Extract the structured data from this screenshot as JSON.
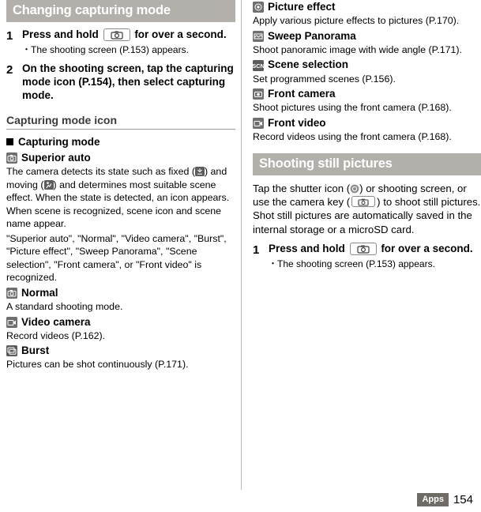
{
  "left": {
    "section_title": "Changing capturing mode",
    "steps": [
      {
        "num": "1",
        "title_pre": "Press and hold",
        "title_post": "for over a second.",
        "bullets": [
          "The shooting screen (P.153) appears."
        ]
      },
      {
        "num": "2",
        "title": "On the shooting screen, tap the capturing mode icon (P.154), then select capturing mode.",
        "bullets": []
      }
    ],
    "sub_head": "Capturing mode icon",
    "block_head": "Capturing mode",
    "modes": [
      {
        "icon": "superior-auto-icon",
        "label": "Superior auto",
        "body": "The camera detects its state such as fixed ( ) and moving ( ) and determines most suitable scene effect. When the state is detected, an icon appears. When scene is recognized, scene icon and scene name appear."
      }
    ],
    "quote_paragraph": "\"Superior auto\", \"Normal\", \"Video camera\", \"Burst\", \"Picture effect\", \"Sweep Panorama\", \"Scene selection\", \"Front camera\", or \"Front video\" is recognized.",
    "modes2": [
      {
        "icon": "normal-icon",
        "label": "Normal",
        "body": "A standard shooting mode."
      },
      {
        "icon": "video-camera-icon",
        "label": "Video camera",
        "body": "Record videos (P.162)."
      },
      {
        "icon": "burst-icon",
        "label": "Burst",
        "body": "Pictures can be shot continuously (P.171)."
      }
    ]
  },
  "right": {
    "modes": [
      {
        "icon": "picture-effect-icon",
        "label": "Picture effect",
        "body": "Apply various picture effects to pictures (P.170)."
      },
      {
        "icon": "sweep-panorama-icon",
        "label": "Sweep Panorama",
        "body": "Shoot panoramic image with wide angle (P.171)."
      },
      {
        "icon": "scene-selection-icon",
        "label": "Scene selection",
        "body": "Set programmed scenes (P.156)."
      },
      {
        "icon": "front-camera-icon",
        "label": "Front camera",
        "body": "Shoot pictures using the front camera (P.168)."
      },
      {
        "icon": "front-video-icon",
        "label": "Front video",
        "body": "Record videos using the front camera (P.168)."
      }
    ],
    "section_title": "Shooting still pictures",
    "intro_1": "Tap the shutter icon (",
    "intro_2": ") or shooting screen, or use the camera key (",
    "intro_3": ") to shoot still pictures. Shot still pictures are automatically saved in the internal storage or a microSD card.",
    "step": {
      "num": "1",
      "title_pre": "Press and hold",
      "title_post": "for over a second.",
      "bullets": [
        "The shooting screen (P.153) appears."
      ]
    }
  },
  "footer": {
    "label": "Apps",
    "page": "154"
  },
  "colors": {
    "section_bar": "#b3b0ac",
    "footer_tab": "#6f6c68"
  }
}
